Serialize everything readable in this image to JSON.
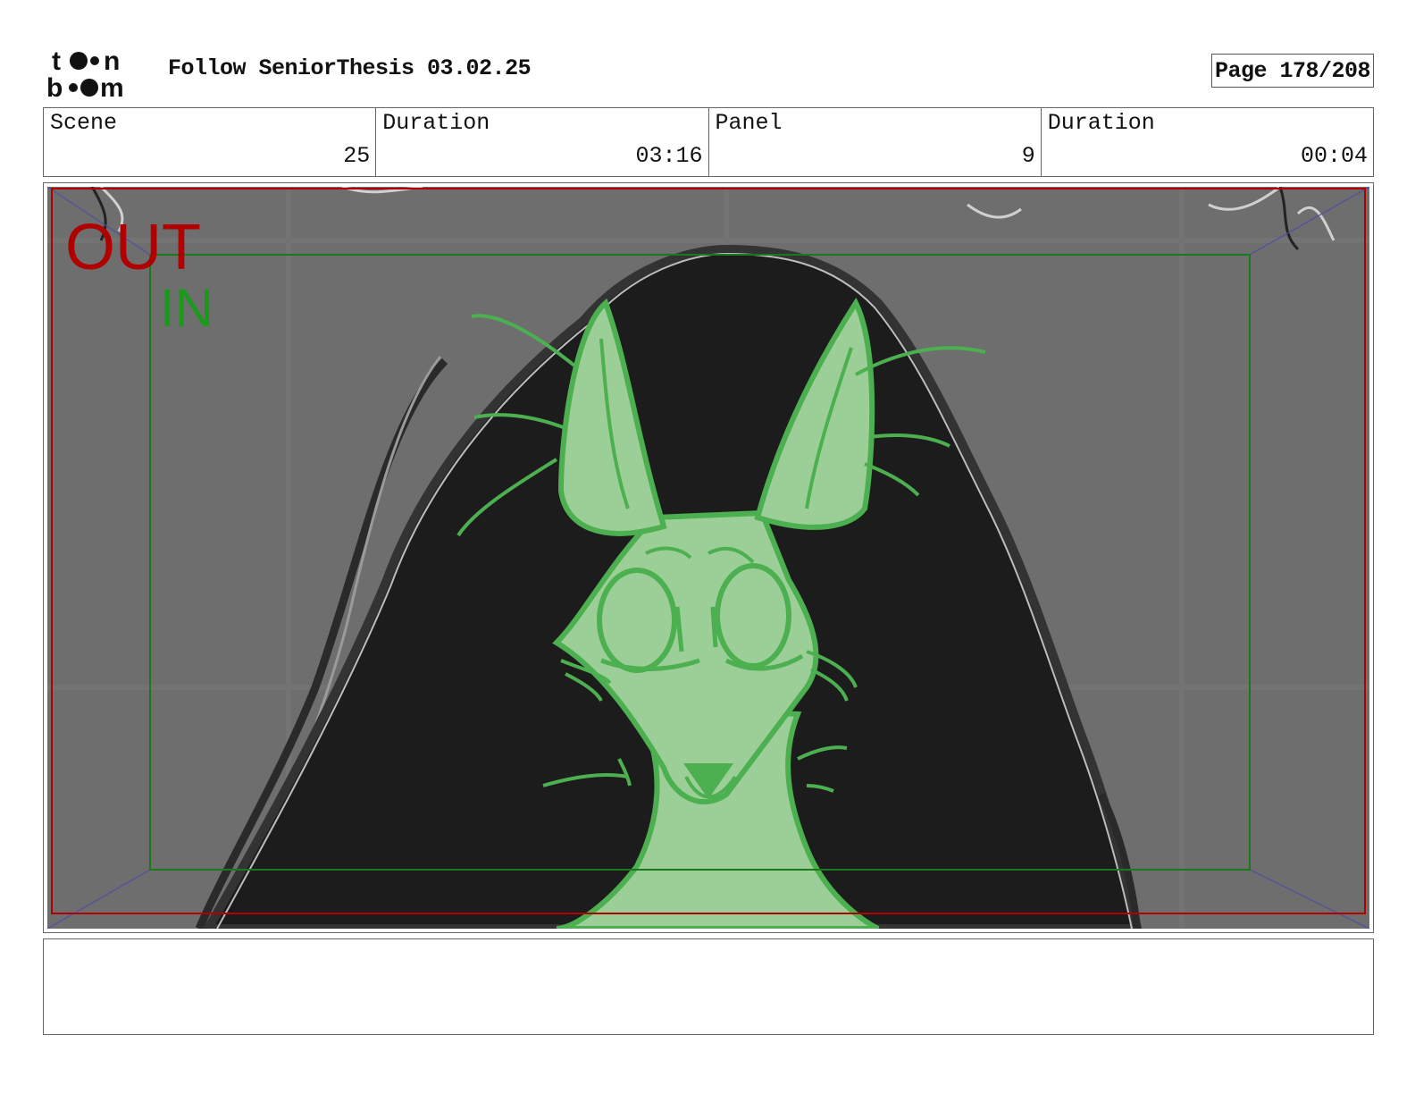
{
  "header": {
    "logo_text": "toon boom",
    "project_title": "Follow SeniorThesis 03.02.25",
    "page": "Page 178/208"
  },
  "info": {
    "scene_label": "Scene",
    "scene_value": "25",
    "scene_duration_label": "Duration",
    "scene_duration_value": "03:16",
    "panel_label": "Panel",
    "panel_value": "9",
    "panel_duration_label": "Duration",
    "panel_duration_value": "00:04"
  },
  "panel": {
    "out_label": "OUT",
    "in_label": "IN",
    "colors": {
      "out_frame": "#b00000",
      "in_frame": "#1a8a1a",
      "character": "#4caf50",
      "background": "#6e6e6e",
      "dark_area": "#1c1c1c"
    }
  },
  "caption": {
    "text": ""
  }
}
